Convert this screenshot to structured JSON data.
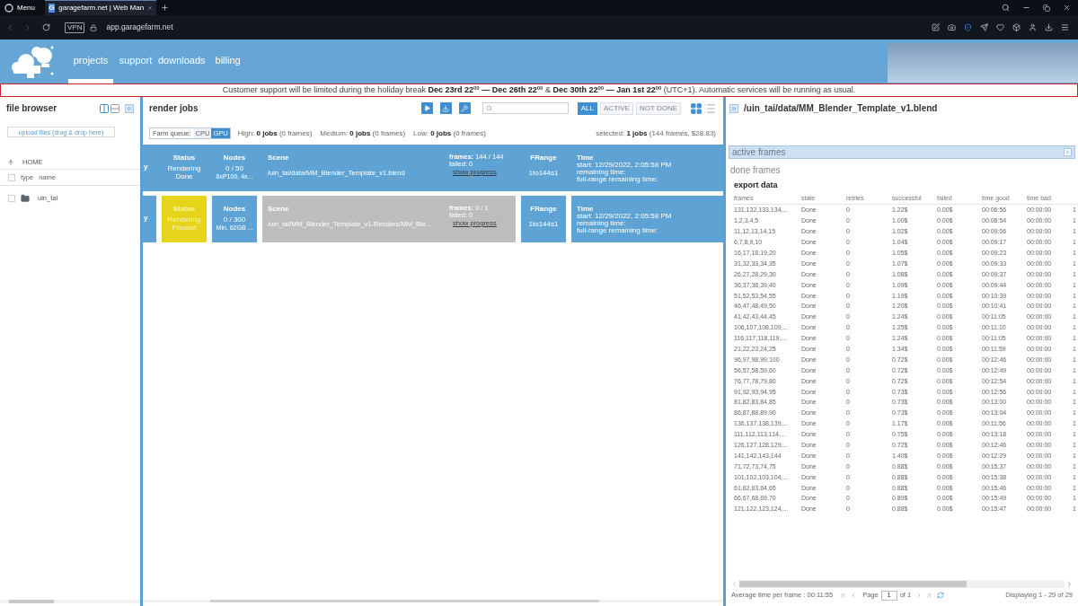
{
  "browser": {
    "menu_label": "Menu",
    "tabs": [
      {
        "favicon_letter": "G",
        "title": "garagefarm.net | Web Man",
        "selected": true
      }
    ],
    "vpn_badge": "VPN",
    "address": "app.garagefarm.net"
  },
  "header": {
    "nav": [
      {
        "label": "projects",
        "selected": true
      },
      {
        "label": "support",
        "selected": false
      },
      {
        "label": "downloads",
        "selected": false
      },
      {
        "label": "billing",
        "selected": false
      }
    ]
  },
  "notice": "Customer support will be limited during the holiday break **Dec 23rd 22**$^{00}$ **— Dec 26th 22**$^{00}$ & **Dec 30th 22**$^{00}$ **— Jan 1st 22**$^{00}$ (UTC+1). Automatic services will be running as usual.",
  "file_browser": {
    "title": "file browser",
    "upload_button": "upload files (drag & drop here)",
    "path": "HOME",
    "header": {
      "checked": false,
      "columns": [
        "type",
        "name"
      ]
    },
    "items": [
      {
        "kind": "folder",
        "name": "uin_tai",
        "checked": false
      }
    ]
  },
  "render_jobs": {
    "title": "render jobs",
    "filters": [
      {
        "label": "ALL",
        "selected": true
      },
      {
        "label": "ACTIVE",
        "selected": false
      },
      {
        "label": "NOT DONE",
        "selected": false
      }
    ],
    "views": [
      {
        "kind": "grid",
        "selected": true
      },
      {
        "kind": "list",
        "selected": false
      }
    ],
    "farm_queue": {
      "label": "Farm queue:",
      "options": [
        {
          "label": "CPU",
          "selected": false
        },
        {
          "label": "GPU",
          "selected": true
        }
      ]
    },
    "queue_stats": [
      "High: **0 jobs** (0 frames)",
      "Medium: **0 jobs** (0 frames)",
      "Low: **0 jobs** (0 frames)"
    ],
    "selection": "selected: **1 jobs** (144 frames, $28.83)",
    "jobs": [
      {
        "selected": true,
        "column_1": "y",
        "status": {
          "heading": "Status",
          "text": "Rendering Done",
          "kind": "done"
        },
        "nodes": {
          "heading": "Nodes",
          "count": "0 / 50",
          "spec": "8xP100, 4x..."
        },
        "scene": {
          "heading": "Scene",
          "path": "/uin_tai/data/MM_Blender_Template_v1.blend",
          "frames": "**frames:** 144 / 144",
          "failed": "failed: 0",
          "link": "show progress"
        },
        "frange": {
          "heading": "FRange",
          "value": "1to144s1"
        },
        "time": {
          "heading": "Time",
          "lines": [
            "start: 12/29/2022, 2:05:58 PM",
            "remaining time:",
            "full-range remaining time:"
          ]
        }
      },
      {
        "selected": false,
        "column_1": "y",
        "status": {
          "heading": "Status",
          "text": "Rendering Paused",
          "kind": "paused"
        },
        "nodes": {
          "heading": "Nodes",
          "count": "0 / 300",
          "spec": "Min. 62GB ..."
        },
        "scene": {
          "heading": "Scene",
          "path": "/uin_tai/MM_Blender_Template_v1-Renders/MM_Ble...",
          "frames": "**frames:** 0 / 1",
          "failed": "failed: 0",
          "link": "show progress"
        },
        "frange": {
          "heading": "FRange",
          "value": "1to144s1"
        },
        "time": {
          "heading": "Time",
          "lines": [
            "start: 12/29/2022, 2:05:58 PM",
            "remaining time:",
            "full-range remaining time:"
          ]
        }
      }
    ]
  },
  "job_details": {
    "title": "/uin_tai/data/MM_Blender_Template_v1.blend",
    "sections": [
      {
        "label": "active frames",
        "highlighted": true
      },
      {
        "label": "done frames",
        "highlighted": false
      }
    ],
    "export": {
      "title": "export data",
      "columns": [
        "frames",
        "state",
        "retries",
        "successful",
        "failed",
        "time good",
        "time bad"
      ],
      "rows": [
        [
          "131,132,133,134,...",
          "Done",
          "0",
          "1.22$",
          "0.00$",
          "00:06:56",
          "00:00:00",
          "1"
        ],
        [
          "1,2,3,4,5",
          "Done",
          "0",
          "1.00$",
          "0.00$",
          "00:08:54",
          "00:00:00",
          "1"
        ],
        [
          "11,12,13,14,15",
          "Done",
          "0",
          "1.02$",
          "0.00$",
          "00:09:06",
          "00:00:00",
          "1"
        ],
        [
          "6,7,8,9,10",
          "Done",
          "0",
          "1.04$",
          "0.00$",
          "00:09:17",
          "00:00:00",
          "1"
        ],
        [
          "16,17,18,19,20",
          "Done",
          "0",
          "1.05$",
          "0.00$",
          "00:09:23",
          "00:00:00",
          "1"
        ],
        [
          "31,32,33,34,35",
          "Done",
          "0",
          "1.07$",
          "0.00$",
          "00:09:33",
          "00:00:00",
          "1"
        ],
        [
          "26,27,28,29,30",
          "Done",
          "0",
          "1.08$",
          "0.00$",
          "00:09:37",
          "00:00:00",
          "1"
        ],
        [
          "36,37,38,39,40",
          "Done",
          "0",
          "1.09$",
          "0.00$",
          "00:09:44",
          "00:00:00",
          "1"
        ],
        [
          "51,52,53,54,55",
          "Done",
          "0",
          "1.19$",
          "0.00$",
          "00:10:39",
          "00:00:00",
          "1"
        ],
        [
          "46,47,48,49,50",
          "Done",
          "0",
          "1.20$",
          "0.00$",
          "00:10:41",
          "00:00:00",
          "1"
        ],
        [
          "41,42,43,44,45",
          "Done",
          "0",
          "1.24$",
          "0.00$",
          "00:11:05",
          "00:00:00",
          "1"
        ],
        [
          "106,107,108,109,...",
          "Done",
          "0",
          "1.25$",
          "0.00$",
          "00:11:10",
          "00:00:00",
          "1"
        ],
        [
          "116,117,118,119,...",
          "Done",
          "0",
          "1.24$",
          "0.00$",
          "00:11:05",
          "00:00:00",
          "1"
        ],
        [
          "21,22,23,24,25",
          "Done",
          "0",
          "1.34$",
          "0.00$",
          "00:11:59",
          "00:00:00",
          "1"
        ],
        [
          "96,97,98,99,100",
          "Done",
          "0",
          "0.72$",
          "0.00$",
          "00:12:46",
          "00:00:00",
          "1"
        ],
        [
          "56,57,58,59,60",
          "Done",
          "0",
          "0.72$",
          "0.00$",
          "00:12:49",
          "00:00:00",
          "1"
        ],
        [
          "76,77,78,79,80",
          "Done",
          "0",
          "0.72$",
          "0.00$",
          "00:12:54",
          "00:00:00",
          "1"
        ],
        [
          "91,92,93,94,95",
          "Done",
          "0",
          "0.73$",
          "0.00$",
          "00:12:56",
          "00:00:00",
          "1"
        ],
        [
          "81,82,83,84,85",
          "Done",
          "0",
          "0.73$",
          "0.00$",
          "00:13:00",
          "00:00:00",
          "1"
        ],
        [
          "86,87,88,89,90",
          "Done",
          "0",
          "0.73$",
          "0.00$",
          "00:13:04",
          "00:00:00",
          "1"
        ],
        [
          "136,137,138,139,...",
          "Done",
          "0",
          "1.17$",
          "0.00$",
          "00:11:56",
          "00:00:00",
          "1"
        ],
        [
          "111,112,113,114,...",
          "Done",
          "0",
          "0.75$",
          "0.00$",
          "00:13:18",
          "00:00:00",
          "1"
        ],
        [
          "126,127,128,129,...",
          "Done",
          "0",
          "0.72$",
          "0.00$",
          "00:12:46",
          "00:00:00",
          "1"
        ],
        [
          "141,142,143,144",
          "Done",
          "0",
          "1.40$",
          "0.00$",
          "00:12:29",
          "00:00:00",
          "1"
        ],
        [
          "71,72,73,74,75",
          "Done",
          "0",
          "0.88$",
          "0.00$",
          "00:15:37",
          "00:00:00",
          "1"
        ],
        [
          "101,102,103,104,...",
          "Done",
          "0",
          "0.88$",
          "0.00$",
          "00:15:38",
          "00:00:00",
          "1"
        ],
        [
          "61,62,63,64,65",
          "Done",
          "0",
          "0.88$",
          "0.00$",
          "00:15:46",
          "00:00:00",
          "1"
        ],
        [
          "66,67,68,69,70",
          "Done",
          "0",
          "0.89$",
          "0.00$",
          "00:15:49",
          "00:00:00",
          "1"
        ],
        [
          "121,122,123,124,...",
          "Done",
          "0",
          "0.88$",
          "0.00$",
          "00:15:47",
          "00:00:00",
          "1"
        ]
      ]
    },
    "pager": {
      "average": "Average time per frame : 00:11:55",
      "page_label": "Page",
      "page": "1",
      "page_total": "of 1",
      "displaying": "Displaying 1 - 29 of 29"
    }
  }
}
